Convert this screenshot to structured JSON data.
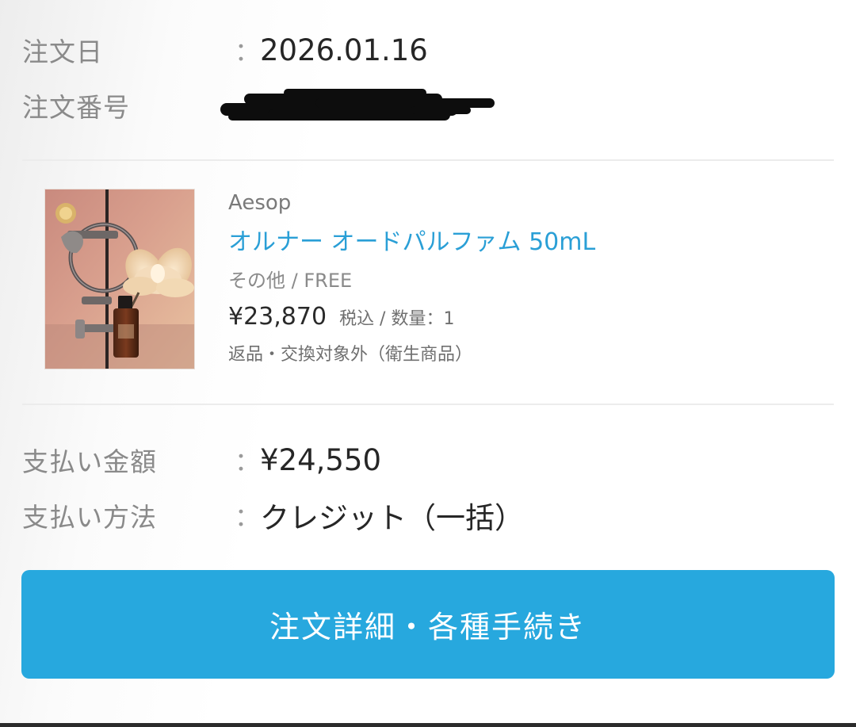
{
  "order": {
    "date_label": "注文日",
    "date_value": "2026.01.16",
    "number_label": "注文番号",
    "number_value_hidden": "redacted"
  },
  "separator": "：",
  "product": {
    "image_icon": "perfume-bottle-photo",
    "brand": "Aesop",
    "name": "オルナー オードパルファム 50mL",
    "variant": "その他 / FREE",
    "price": "¥23,870",
    "price_meta": "税込 / 数量：1",
    "return_note": "返品・交換対象外（衛生商品）"
  },
  "payment": {
    "amount_label": "支払い金額",
    "amount_value": "¥24,550",
    "method_label": "支払い方法",
    "method_value": "クレジット（一括）"
  },
  "cta": {
    "label": "注文詳細・各種手続き"
  },
  "colors": {
    "accent": "#27a8de",
    "link": "#2a9fd6",
    "label_gray": "#8a8a8a"
  }
}
